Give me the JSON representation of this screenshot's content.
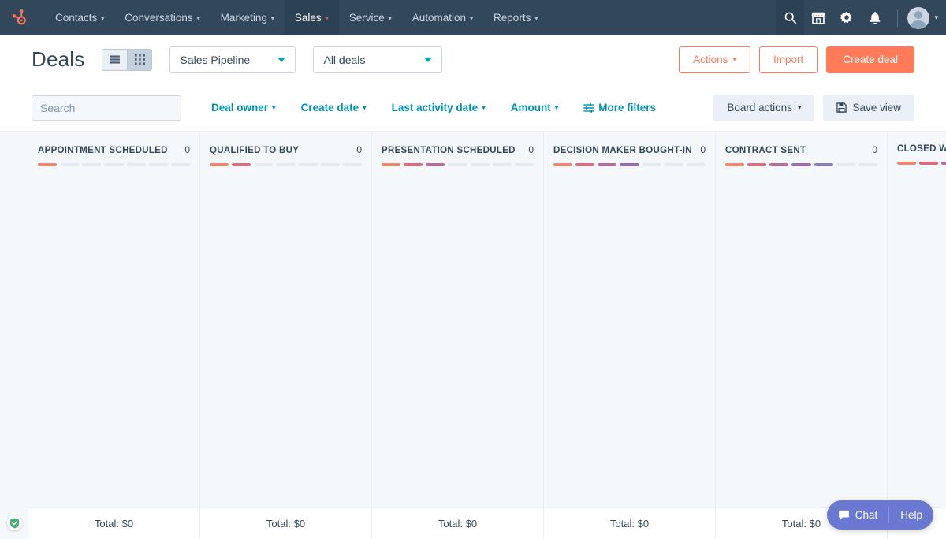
{
  "topnav": {
    "logo": "hubspot-sprocket-logo",
    "items": [
      {
        "label": "Contacts",
        "active": false
      },
      {
        "label": "Conversations",
        "active": false
      },
      {
        "label": "Marketing",
        "active": false
      },
      {
        "label": "Sales",
        "active": true
      },
      {
        "label": "Service",
        "active": false
      },
      {
        "label": "Automation",
        "active": false
      },
      {
        "label": "Reports",
        "active": false
      }
    ],
    "icons": [
      {
        "name": "search-icon",
        "selected": true
      },
      {
        "name": "marketplace-icon",
        "selected": false
      },
      {
        "name": "settings-gear-icon",
        "selected": false
      },
      {
        "name": "notifications-bell-icon",
        "selected": false
      }
    ],
    "background": "#33475b",
    "accent": "#f2545b"
  },
  "header": {
    "title": "Deals",
    "view_toggle": {
      "list_label": "list-view",
      "board_label": "board-view",
      "active": "board"
    },
    "pipeline_select": "Sales Pipeline",
    "view_select": "All deals",
    "actions_label": "Actions",
    "import_label": "Import",
    "create_label": "Create deal",
    "primary_color": "#ff7a59"
  },
  "filterbar": {
    "search_placeholder": "Search",
    "search_value": "",
    "filters": [
      {
        "label": "Deal owner",
        "caret": true
      },
      {
        "label": "Create date",
        "caret": true
      },
      {
        "label": "Last activity date",
        "caret": true
      },
      {
        "label": "Amount",
        "caret": true
      },
      {
        "label": "More filters",
        "caret": false
      }
    ],
    "board_actions_label": "Board actions",
    "save_view_label": "Save view",
    "link_color": "#0091ae"
  },
  "board": {
    "total_prefix": "Total: ",
    "stage_colors": [
      "#f5846b",
      "#e0697f",
      "#bc6a9c",
      "#9b6cba",
      "#8a7dc4",
      "#e5eaf0",
      "#e5eaf0"
    ],
    "segment_count": 7,
    "columns": [
      {
        "name": "APPOINTMENT SCHEDULED",
        "count": "0",
        "filled": 1,
        "total": "Total: $0"
      },
      {
        "name": "QUALIFIED TO BUY",
        "count": "0",
        "filled": 2,
        "total": "Total: $0"
      },
      {
        "name": "PRESENTATION SCHEDULED",
        "count": "0",
        "filled": 3,
        "total": "Total: $0"
      },
      {
        "name": "DECISION MAKER BOUGHT-IN",
        "count": "0",
        "filled": 4,
        "total": "Total: $0"
      },
      {
        "name": "CONTRACT SENT",
        "count": "0",
        "filled": 5,
        "total": "Total: $0"
      },
      {
        "name": "CLOSED WON",
        "count": "",
        "filled": 6,
        "total": ""
      }
    ]
  },
  "widgets": {
    "chat_label": "Chat",
    "help_label": "Help",
    "chat_color": "#6a78d1",
    "extension_badge": "shield-check-icon"
  }
}
